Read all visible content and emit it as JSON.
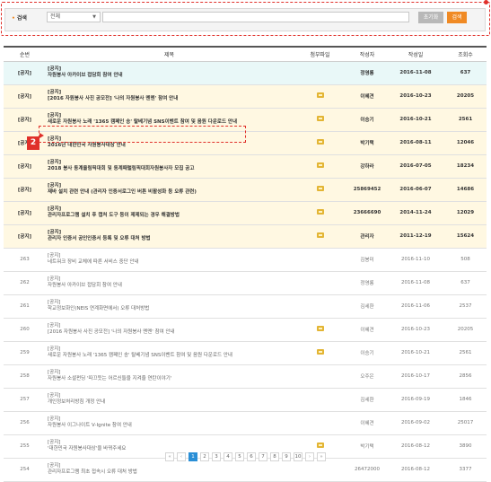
{
  "search": {
    "label": "검색",
    "select_value": "전체",
    "input_value": "",
    "reset_label": "초기화",
    "search_label": "검색"
  },
  "table": {
    "headers": [
      "순번",
      "제목",
      "첨부파일",
      "작성자",
      "작성일",
      "조회수"
    ],
    "rows": [
      {
        "no": "[공지]",
        "tag": "[공지]",
        "title": "자원봉사 아카이브 접담회 참여 안내",
        "file": false,
        "author": "정영롱",
        "date": "2016-11-08",
        "views": "637",
        "notice": true
      },
      {
        "no": "[공지]",
        "tag": "[공지]",
        "title": "[2016 자원봉사 사진 공모전] '나의 자원봉사 멘멘' 참여 안내",
        "file": true,
        "author": "이혜견",
        "date": "2016-10-23",
        "views": "20205",
        "notice": true
      },
      {
        "no": "[공지]",
        "tag": "[공지]",
        "title": "새로운 자원봉사 노래 '1365 캠페인 송' 탈베기념 SNS이벤트 참여 및 음원 다운로드 안내",
        "file": true,
        "author": "이승기",
        "date": "2016-10-21",
        "views": "2561",
        "notice": true
      },
      {
        "no": "[공지]",
        "tag": "[공지]",
        "title": "2016년 대한민국 자원봉사대상 안내",
        "file": true,
        "author": "박기택",
        "date": "2016-08-11",
        "views": "12046",
        "notice": true
      },
      {
        "no": "[공지]",
        "tag": "[공지]",
        "title": "2018 봉사 동계올림픽대회 및 동계패럴림픽대회자원봉사자 모집 공고",
        "file": true,
        "author": "강하라",
        "date": "2016-07-05",
        "views": "18234",
        "notice": true
      },
      {
        "no": "[공지]",
        "tag": "[공지]",
        "title": "재바 설치 관련 안내 (관리자 인증서로그인 버튼 비활성화 등 오류 관련)",
        "file": true,
        "author": "25869452",
        "date": "2016-06-07",
        "views": "14686",
        "notice": true
      },
      {
        "no": "[공지]",
        "tag": "[공지]",
        "title": "관리자프로그램 설치 후 캡처 도구 등이 제제되는 경우 해결방법",
        "file": true,
        "author": "23666690",
        "date": "2014-11-24",
        "views": "12029",
        "notice": true
      },
      {
        "no": "[공지]",
        "tag": "[공지]",
        "title": "관리자 인증서 공인인증서 등록 및 오류 대처 방법",
        "file": true,
        "author": "관리자",
        "date": "2011-12-19",
        "views": "15624",
        "notice": true
      },
      {
        "no": "263",
        "tag": "[공지]",
        "title": "네트워크 장비 교체에 따른 서비스 중단 안내",
        "file": false,
        "author": "김봉미",
        "date": "2016-11-10",
        "views": "508",
        "notice": false
      },
      {
        "no": "262",
        "tag": "[공지]",
        "title": "자원봉사 아카이브 접담회 참여 안내",
        "file": false,
        "author": "정영롱",
        "date": "2016-11-08",
        "views": "637",
        "notice": false
      },
      {
        "no": "261",
        "tag": "[공지]",
        "title": "학교정보화인(NEIS 연계화면에서) 오류 대처방법",
        "file": false,
        "author": "김세환",
        "date": "2016-11-06",
        "views": "2537",
        "notice": false
      },
      {
        "no": "260",
        "tag": "[공지]",
        "title": "[2016 자원봉사 사진 공모전] '나의 자원봉사 멘멘' 참여 안내",
        "file": true,
        "author": "이혜견",
        "date": "2016-10-23",
        "views": "20205",
        "notice": false
      },
      {
        "no": "259",
        "tag": "[공지]",
        "title": "새로운 자원봉사 노래 '1365 캠페인 송' 탈베기념 SNS이벤트 참여 및 음원 다운로드 안내",
        "file": true,
        "author": "이승기",
        "date": "2016-10-21",
        "views": "2561",
        "notice": false
      },
      {
        "no": "258",
        "tag": "[공지]",
        "title": "자원봉사 소셜펀딩 '따끄듯는 어르신들을 지켜줄 연탄이야기'",
        "file": false,
        "author": "오주은",
        "date": "2016-10-17",
        "views": "2856",
        "notice": false
      },
      {
        "no": "257",
        "tag": "[공지]",
        "title": "개인정보처리방침 개정 안내",
        "file": false,
        "author": "김세환",
        "date": "2016-09-19",
        "views": "1846",
        "notice": false
      },
      {
        "no": "256",
        "tag": "[공지]",
        "title": "자원봉사 이그나이트 V-Ignite 참여 안내",
        "file": false,
        "author": "이혜견",
        "date": "2016-09-02",
        "views": "25017",
        "notice": false
      },
      {
        "no": "255",
        "tag": "[공지]",
        "title": "'대한민국 자원봉사대상'을 바뀌주세요",
        "file": true,
        "author": "박기택",
        "date": "2016-08-12",
        "views": "3890",
        "notice": false
      },
      {
        "no": "254",
        "tag": "[공지]",
        "title": "관리자프로그램 최초 접속시 오류 대처 방법",
        "file": false,
        "author": "26472000",
        "date": "2016-08-12",
        "views": "3377",
        "notice": false
      }
    ]
  },
  "callout": {
    "number": "2"
  },
  "pagination": {
    "first": "«",
    "prev": "‹",
    "pages": [
      "1",
      "2",
      "3",
      "4",
      "5",
      "6",
      "7",
      "8",
      "9",
      "10"
    ],
    "active_page": "1",
    "next": "›",
    "last": "»"
  }
}
